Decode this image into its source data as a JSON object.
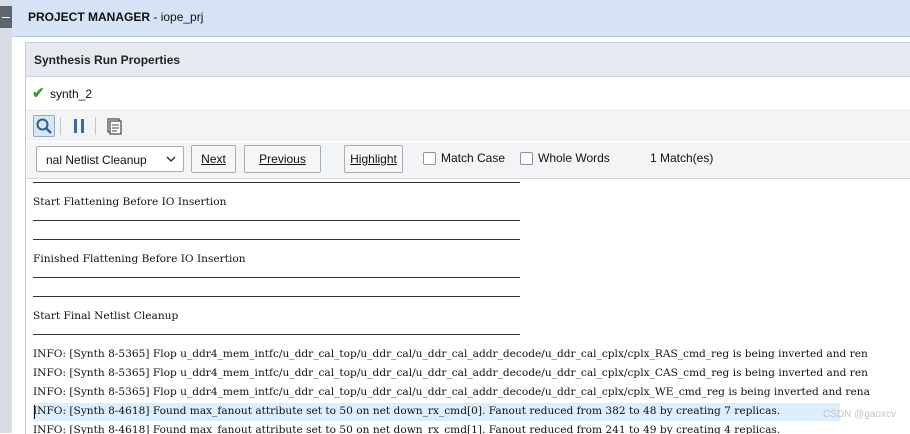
{
  "header": {
    "label": "PROJECT MANAGER",
    "separator": " - ",
    "project": "iope_prj",
    "collapse_glyph": "–"
  },
  "panel": {
    "title": "Synthesis Run Properties",
    "run_name": "synth_2"
  },
  "toolbar": {
    "buttons": [
      {
        "name": "search-icon"
      },
      {
        "name": "pause-icon"
      },
      {
        "name": "copy-icon"
      }
    ]
  },
  "find_bar": {
    "combo_value": "nal Netlist Cleanup",
    "next_label": "Next",
    "previous_label": "Previous",
    "highlight_label": "Highlight",
    "match_case_label": "Match Case",
    "whole_words_label": "Whole Words",
    "match_count": "1 Match(es)"
  },
  "log": {
    "sections": [
      "Start Flattening Before IO Insertion",
      "Finished Flattening Before IO Insertion",
      "Start Final Netlist Cleanup"
    ],
    "lines": [
      "INFO: [Synth 8-5365] Flop u_ddr4_mem_intfc/u_ddr_cal_top/u_ddr_cal/u_ddr_cal_addr_decode/u_ddr_cal_cplx/cplx_RAS_cmd_reg is being inverted and ren",
      "INFO: [Synth 8-5365] Flop u_ddr4_mem_intfc/u_ddr_cal_top/u_ddr_cal/u_ddr_cal_addr_decode/u_ddr_cal_cplx/cplx_CAS_cmd_reg is being inverted and ren",
      "INFO: [Synth 8-5365] Flop u_ddr4_mem_intfc/u_ddr_cal_top/u_ddr_cal/u_ddr_cal_addr_decode/u_ddr_cal_cplx/cplx_WE_cmd_reg is being inverted and rena",
      "INFO: [Synth 8-4618] Found max_fanout attribute set to 50 on net down_rx_cmd[0]. Fanout reduced from 382 to 48 by creating 7 replicas.",
      "INFO: [Synth 8-4618] Found max_fanout attribute set to 50 on net down_rx_cmd[1]. Fanout reduced from 241 to 49 by creating 4 replicas."
    ]
  },
  "watermark": "CSDN @gaoxcv",
  "colors": {
    "header_bg": "#d6e3f7",
    "check_green": "#2e9b3c",
    "highlight_row": "#dceefc"
  }
}
